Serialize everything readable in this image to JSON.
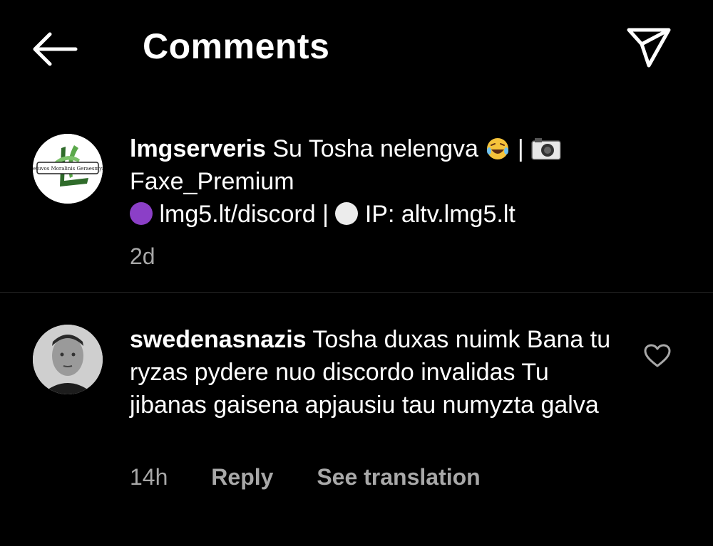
{
  "header": {
    "title": "Comments",
    "back_icon": "arrow-left-icon",
    "send_icon": "paper-plane-icon"
  },
  "caption": {
    "username": "lmgserveris",
    "text_line1": "Su Tosha nelengva",
    "sep1": "|",
    "text_line2": "Faxe_Premium",
    "discord": "lmg5.lt/discord |",
    "ip": "IP: altv.lmg5.lt",
    "time": "2d",
    "avatar_text": "Lietuvos Moralinis Geraesmyas"
  },
  "comment": {
    "username": "swedenasnazis",
    "text": "Tosha duxas nuimk Bana tu ryzas pydere nuo discordo invalidas Tu jibanas gaisena apjausiu tau numyzta galva",
    "time": "14h",
    "reply_label": "Reply",
    "translate_label": "See translation",
    "like_icon": "heart-outline-icon"
  },
  "colors": {
    "background": "#000000",
    "text": "#ffffff",
    "meta": "#a8a8a8",
    "divider": "#262626",
    "purple_dot": "#8b3fc7"
  }
}
